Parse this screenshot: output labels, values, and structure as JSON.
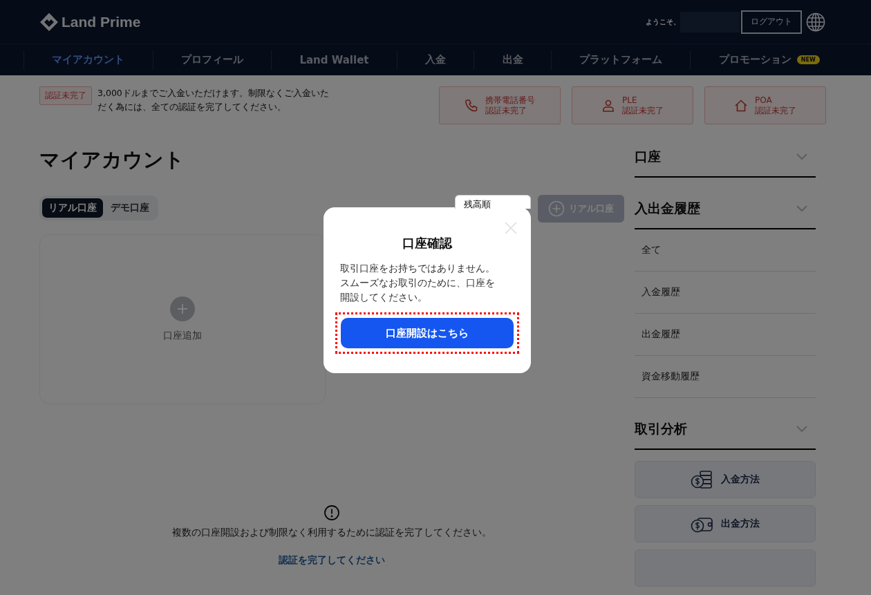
{
  "header": {
    "logo": "Land Prime",
    "welcome": "ようこそ、",
    "logout": "ログアウト"
  },
  "nav": [
    {
      "label": "マイアカウント",
      "selected": true
    },
    {
      "label": "プロフィール",
      "selected": false
    },
    {
      "label": "Land Wallet",
      "selected": false
    },
    {
      "label": "入金",
      "selected": false
    },
    {
      "label": "出金",
      "selected": false
    },
    {
      "label": "プラットフォーム",
      "selected": false
    },
    {
      "label": "プロモーション",
      "selected": false,
      "badge": "NEW"
    }
  ],
  "notice": {
    "tag": "認証未完了",
    "text": "3,000ドルまでご入金いただけます。制限なくご入金いただく為には、全ての認証を完了してください。"
  },
  "verifications": [
    {
      "kind": "phone",
      "title": "携帯電話番号",
      "status": "認証未完了"
    },
    {
      "kind": "person",
      "title": "PLE",
      "status": "認証未完了"
    },
    {
      "kind": "home",
      "title": "POA",
      "status": "認証未完了"
    }
  ],
  "page_title": "マイアカウント",
  "account_tabs": [
    {
      "label": "リアル口座",
      "selected": true
    },
    {
      "label": "デモ口座",
      "selected": false
    }
  ],
  "sort_select": {
    "value": "残高順"
  },
  "add_real_button": "リアル口座",
  "add_card": {
    "label": "口座追加"
  },
  "bottom_notice": {
    "text": "複数の口座開設および制限なく利用するために認証を完了してください。",
    "link": "認証を完了してください"
  },
  "sidebar": [
    {
      "title": "口座"
    },
    {
      "title": "入出金履歴",
      "children": [
        {
          "label": "全て"
        },
        {
          "label": "入金履歴"
        },
        {
          "label": "出金履歴"
        },
        {
          "label": "資金移動履歴"
        }
      ]
    },
    {
      "title": "取引分析"
    }
  ],
  "method_cards": [
    {
      "kind": "coins",
      "label": "入金方法"
    },
    {
      "kind": "wallet",
      "label": "出金方法"
    },
    {
      "kind": "blank"
    }
  ],
  "modal": {
    "title": "口座確認",
    "body": "取引口座をお持ちではありません。スムーズなお取引のために、口座を開設してください。",
    "button": "口座開設はこちら",
    "highlighted": true
  }
}
